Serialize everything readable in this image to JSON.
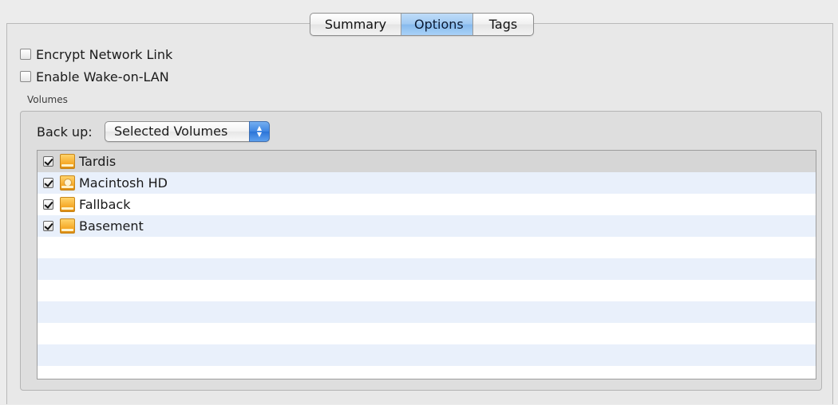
{
  "tabs": [
    {
      "label": "Summary",
      "active": false
    },
    {
      "label": "Options",
      "active": true
    },
    {
      "label": "Tags",
      "active": false
    }
  ],
  "options": {
    "encrypt_label": "Encrypt Network Link",
    "encrypt_checked": false,
    "wake_label": "Enable Wake-on-LAN",
    "wake_checked": false
  },
  "volumes": {
    "group_label": "Volumes",
    "backup_label": "Back up:",
    "backup_selected": "Selected Volumes",
    "items": [
      {
        "name": "Tardis",
        "checked": true,
        "icon": "external-drive-icon",
        "selected": true
      },
      {
        "name": "Macintosh HD",
        "checked": true,
        "icon": "internal-drive-icon",
        "selected": false
      },
      {
        "name": "Fallback",
        "checked": true,
        "icon": "external-drive-icon",
        "selected": false
      },
      {
        "name": "Basement",
        "checked": true,
        "icon": "external-drive-icon",
        "selected": false
      }
    ]
  },
  "colors": {
    "active_tab": "#9fc9f2",
    "stripe": "#e9f0fb",
    "selected_row": "#d6d6d6",
    "popup_arrow": "#3f86e2",
    "drive_icon": "#f5a623"
  }
}
